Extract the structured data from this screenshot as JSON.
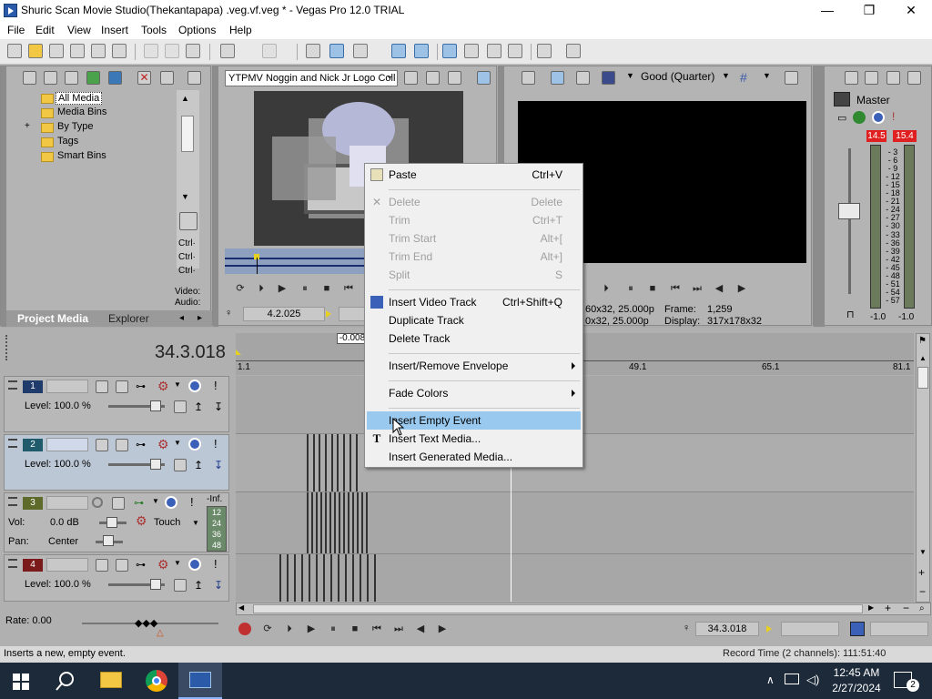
{
  "window": {
    "title": "Shuric Scan Movie Studio(Thekantapapa) .veg.vf.veg * - Vegas Pro 12.0 TRIAL",
    "minimize": "—",
    "maximize": "❐",
    "close": "✕"
  },
  "menubar": [
    "File",
    "Edit",
    "View",
    "Insert",
    "Tools",
    "Options",
    "Help"
  ],
  "project_media": {
    "tree": [
      "All Media",
      "Media Bins",
      "By Type",
      "Tags",
      "Smart Bins"
    ],
    "expand_glyph": "+",
    "right_labels": [
      "Ctrl·",
      "Ctrl·",
      "Ctrl·"
    ],
    "side_labels": [
      "Video:",
      "Audio:"
    ],
    "tabs": [
      "Project Media",
      "Explorer"
    ]
  },
  "trimmer": {
    "media_select": "YTPMV Noggin and Nick Jr Logo Coll",
    "timecode": "4.2.025",
    "offset_label": "-0.008"
  },
  "preview": {
    "quality": "Good (Quarter)",
    "info_project": "60x32, 25.000p",
    "info_preview": "0x32, 25.000p",
    "frame_label": "Frame:",
    "frame_value": "1,259",
    "display_label": "Display:",
    "display_value": "317x178x32"
  },
  "master": {
    "title": "Master",
    "peak_left": "14.5",
    "peak_right": "15.4",
    "scale": [
      "3",
      "6",
      "9",
      "12",
      "15",
      "18",
      "21",
      "24",
      "27",
      "30",
      "33",
      "36",
      "39",
      "42",
      "45",
      "48",
      "51",
      "54",
      "57"
    ],
    "level_left": "-1.0",
    "level_right": "-1.0"
  },
  "timeline": {
    "cursor_time": "34.3.018",
    "ruler": [
      "1.1",
      "49.1",
      "65.1",
      "81.1"
    ],
    "tracks": [
      {
        "num": "1",
        "type": "video",
        "level_label": "Level: 100.0 %"
      },
      {
        "num": "2",
        "type": "video",
        "level_label": "Level: 100.0 %"
      },
      {
        "num": "3",
        "type": "audio",
        "vol_label": "Vol:",
        "vol_value": "0.0 dB",
        "pan_label": "Pan:",
        "pan_value": "Center",
        "automation": "Touch",
        "meter_top": "-Inf.",
        "meter_scale": [
          "12",
          "24",
          "36",
          "48"
        ]
      },
      {
        "num": "4",
        "type": "video",
        "level_label": "Level: 100.0 %"
      }
    ],
    "rate_label": "Rate: 0.00",
    "end_time": "34.3.018"
  },
  "context_menu": {
    "items": [
      {
        "label": "Paste",
        "shortcut": "Ctrl+V",
        "enabled": true,
        "icon": "paste-icon"
      },
      {
        "label": "Delete",
        "shortcut": "Delete",
        "enabled": false,
        "icon": "delete-icon"
      },
      {
        "label": "Trim",
        "shortcut": "Ctrl+T",
        "enabled": false
      },
      {
        "label": "Trim Start",
        "shortcut": "Alt+[",
        "enabled": false
      },
      {
        "label": "Trim End",
        "shortcut": "Alt+]",
        "enabled": false
      },
      {
        "label": "Split",
        "shortcut": "S",
        "enabled": false
      },
      {
        "label": "Insert Video Track",
        "shortcut": "Ctrl+Shift+Q",
        "enabled": true,
        "icon": "video-track-icon"
      },
      {
        "label": "Duplicate Track",
        "shortcut": "",
        "enabled": true
      },
      {
        "label": "Delete Track",
        "shortcut": "",
        "enabled": true
      },
      {
        "label": "Insert/Remove Envelope",
        "shortcut": "",
        "enabled": true,
        "submenu": true
      },
      {
        "label": "Fade Colors",
        "shortcut": "",
        "enabled": true,
        "submenu": true
      },
      {
        "label": "Insert Empty Event",
        "shortcut": "",
        "enabled": true,
        "highlighted": true
      },
      {
        "label": "Insert Text Media...",
        "shortcut": "",
        "enabled": true,
        "icon": "text-media-icon"
      },
      {
        "label": "Insert Generated Media...",
        "shortcut": "",
        "enabled": true
      }
    ]
  },
  "statusbar": {
    "hint": "Inserts a new, empty event.",
    "record_time": "Record Time (2 channels): 111:51:40"
  },
  "taskbar": {
    "time": "12:45 AM",
    "date": "2/27/2024",
    "notifications": "2"
  },
  "colors": {
    "accent": "#99c9ef",
    "track_video": "#1f3b6b",
    "track_audio": "#5e6a2a",
    "track_red": "#7a1a1a",
    "peak": "#e02020"
  }
}
